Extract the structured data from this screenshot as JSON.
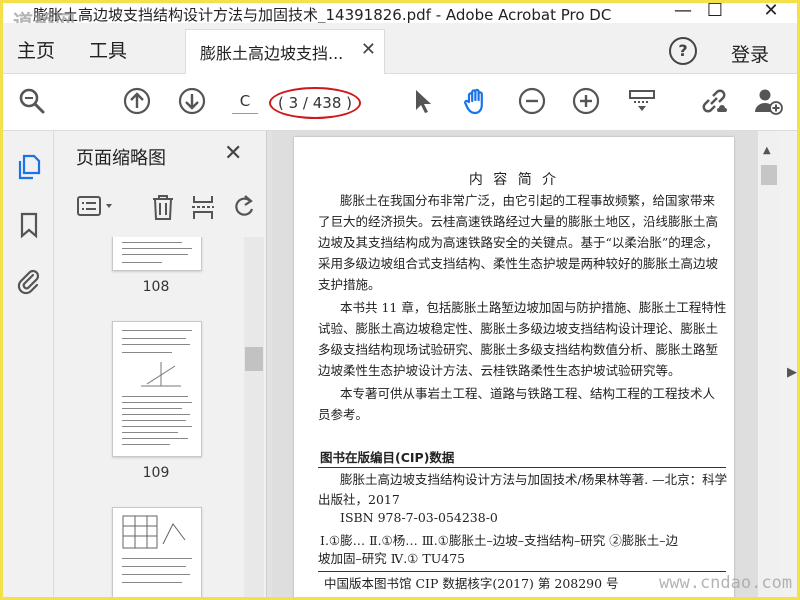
{
  "window": {
    "title": "膨胀土高边坡支挡结构设计方法与加固技术_14391826.pdf - Adobe Acrobat Pro DC",
    "watermark_top": "道桥网",
    "minimize": "—",
    "maximize": "☐",
    "close": "✕"
  },
  "menu": {
    "home": "主页",
    "tools": "工具",
    "tab_label": "膨胀土高边坡支挡...",
    "tab_close": "✕",
    "help": "?",
    "login": "登录"
  },
  "toolbar": {
    "page_current": "C",
    "page_count": "( 3 / 438 )"
  },
  "thumbnails": {
    "title": "页面缩略图",
    "close": "✕",
    "pages": [
      "108",
      "109"
    ]
  },
  "document": {
    "heading": "内 容 简 介",
    "lines": [
      "膨胀土在我国分布非常广泛，由它引起的工程事故频繁，给国家带来",
      "了巨大的经济损失。云桂高速铁路经过大量的膨胀土地区，沿线膨胀土高",
      "边坡及其支挡结构成为高速铁路安全的关键点。基于“以柔治胀”的理念，",
      "采用多级边坡组合式支挡结构、柔性生态护坡是两种较好的膨胀土高边坡",
      "支护措施。",
      "本书共 11 章，包括膨胀土路堑边坡加固与防护措施、膨胀土工程特性",
      "试验、膨胀土高边坡稳定性、膨胀土多级边坡支挡结构设计理论、膨胀土",
      "多级支挡结构现场试验研究、膨胀土多级支挡结构数值分析、膨胀土路堑",
      "边坡柔性生态护坡设计方法、云桂铁路柔性生态护坡试验研究等。",
      "本专著可供从事岩土工程、道路与铁路工程、结构工程的工程技术人",
      "员参考。"
    ],
    "cip_heading": "图书在版编目(CIP)数据",
    "cip_lines": [
      "膨胀土高边坡支挡结构设计方法与加固技术/杨果林等著. —北京：科学",
      "出版社，2017",
      "ISBN 978-7-03-054238-0",
      "Ⅰ.①膨…  Ⅱ.①杨…  Ⅲ.①膨胀土–边坡–支挡结构–研究  ②膨胀土–边",
      "坡加固–研究  Ⅳ.①  TU475",
      "中国版本图书馆 CIP 数据核字(2017) 第 208290 号"
    ]
  },
  "watermark_bottom": "www.cndao.com"
}
